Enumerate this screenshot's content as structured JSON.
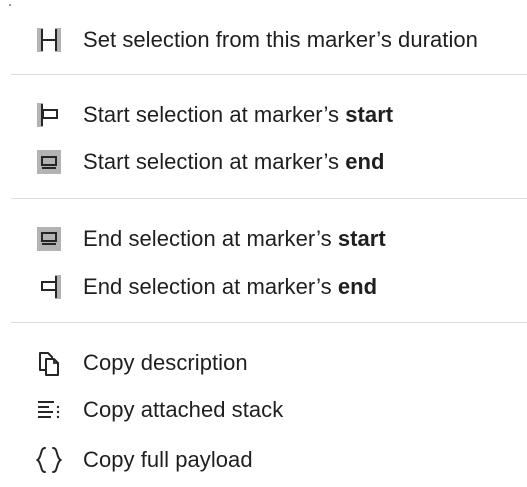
{
  "menu": {
    "items": [
      {
        "name": "set-selection-from-duration",
        "icon": "selection-duration-icon",
        "label": "Set selection from this marker’s duration",
        "label_main": "",
        "label_bold": ""
      },
      {
        "name": "start-selection-at-start",
        "icon": "selection-start-at-start-icon",
        "label": "",
        "label_main": "Start selection at marker’s ",
        "label_bold": "start"
      },
      {
        "name": "start-selection-at-end",
        "icon": "selection-start-at-end-icon",
        "label": "",
        "label_main": "Start selection at marker’s ",
        "label_bold": "end"
      },
      {
        "name": "end-selection-at-start",
        "icon": "selection-end-at-start-icon",
        "label": "",
        "label_main": "End selection at marker’s ",
        "label_bold": "start"
      },
      {
        "name": "end-selection-at-end",
        "icon": "selection-end-at-end-icon",
        "label": "",
        "label_main": "End selection at marker’s ",
        "label_bold": "end"
      },
      {
        "name": "copy-description",
        "icon": "copy-icon",
        "label": "Copy description",
        "label_main": "",
        "label_bold": ""
      },
      {
        "name": "copy-attached-stack",
        "icon": "stack-icon",
        "label": "Copy attached stack",
        "label_main": "",
        "label_bold": ""
      },
      {
        "name": "copy-full-payload",
        "icon": "braces-icon",
        "label": "Copy full payload",
        "label_main": "",
        "label_bold": ""
      }
    ]
  },
  "colors": {
    "text": "#1f1f1f",
    "separator": "#dedede",
    "icon_fill": "#b3b3b3",
    "icon_stroke": "#262626"
  }
}
